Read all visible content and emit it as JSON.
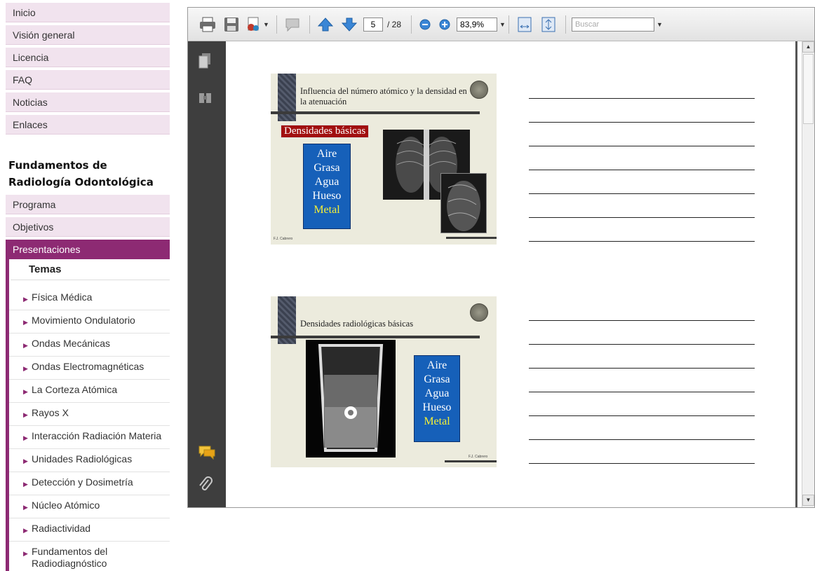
{
  "sidebar": {
    "top_items": [
      {
        "label": "Inicio"
      },
      {
        "label": "Visión general"
      },
      {
        "label": "Licencia"
      },
      {
        "label": "FAQ"
      },
      {
        "label": "Noticias"
      },
      {
        "label": "Enlaces"
      }
    ],
    "section_title": "Fundamentos de Radiología Odontológica",
    "course_items": [
      {
        "label": "Programa"
      },
      {
        "label": "Objetivos"
      }
    ],
    "active_item": "Presentaciones",
    "sub_heading": "Temas",
    "topics": [
      "Física Médica",
      "Movimiento Ondulatorio",
      "Ondas Mecánicas",
      "Ondas Electromagnéticas",
      "La Corteza Atómica",
      "Rayos X",
      "Interacción Radiación Materia",
      "Unidades Radiológicas",
      "Detección y Dosimetría",
      "Núcleo Atómico",
      "Radiactividad",
      "Fundamentos del Radiodiagnóstico"
    ]
  },
  "viewer": {
    "page_current": "5",
    "page_total": "/ 28",
    "zoom": "83,9%",
    "search_placeholder": "Buscar",
    "icons": {
      "print": "print-icon",
      "save": "save-icon",
      "share": "share-icon",
      "comment": "comment-icon",
      "prev": "arrow-up-icon",
      "next": "arrow-down-icon",
      "zoom_out": "zoom-out-icon",
      "zoom_in": "zoom-in-icon",
      "fit_width": "fit-width-icon",
      "fit_page": "fit-page-icon"
    }
  },
  "slides": [
    {
      "title": "Influencia del número atómico y la densidad en la atenuación",
      "badge": "Densidades básicas",
      "densities": [
        "Aire",
        "Grasa",
        "Agua",
        "Hueso"
      ],
      "metal": "Metal",
      "footer": "F.J. Cabrero"
    },
    {
      "title": "Densidades radiológicas básicas",
      "densities": [
        "Aire",
        "Grasa",
        "Agua",
        "Hueso"
      ],
      "metal": "Metal",
      "footer": "F.J. Cabrero"
    }
  ],
  "colors": {
    "accent": "#8d2a73",
    "nav_bg": "#f1e3ee",
    "viewer_sidebar": "#3e3e3e",
    "slide_bg": "#ecebdd",
    "density_box": "#1660b9",
    "badge_red": "#a10f0f",
    "metal_text": "#f5f036"
  }
}
